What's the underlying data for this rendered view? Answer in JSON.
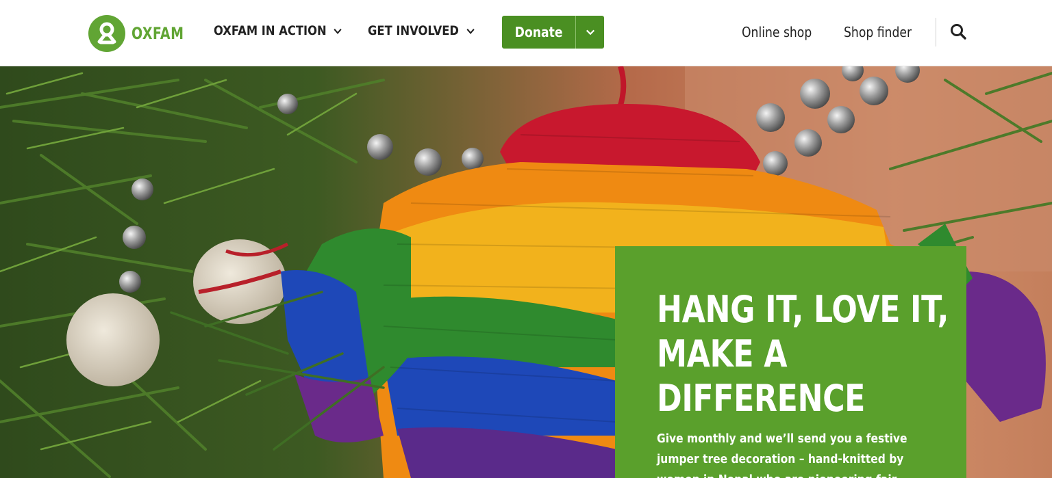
{
  "header": {
    "logo_text": "OXFAM",
    "nav": [
      {
        "label": "OXFAM IN ACTION"
      },
      {
        "label": "GET INVOLVED"
      }
    ],
    "donate_label": "Donate",
    "utility_links": [
      {
        "label": "Online shop"
      },
      {
        "label": "Shop finder"
      }
    ]
  },
  "hero": {
    "headline": "HANG IT, LOVE IT, MAKE A DIFFERENCE",
    "body": "Give monthly and we’ll send you a festive jumper tree decoration – hand-knitted by women in Nepal who are pioneering fair"
  },
  "icons": {
    "logo": "oxfam-logo-icon",
    "nav_chevron": "chevron-down-icon",
    "donate_chevron": "chevron-down-icon",
    "search": "search-icon"
  },
  "colors": {
    "brand_green": "#61a534",
    "donate_green": "#4a8f22",
    "promo_green": "#5aa02c",
    "nav_text": "#222222"
  }
}
